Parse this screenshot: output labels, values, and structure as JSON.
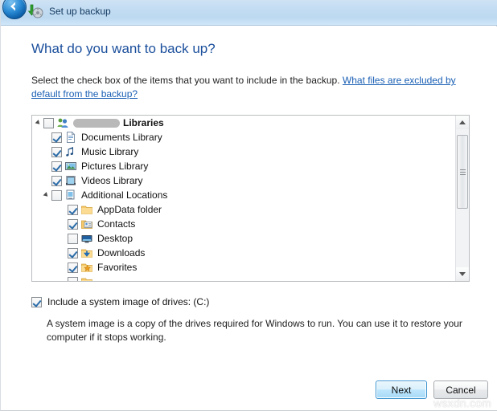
{
  "window": {
    "title": "Set up backup",
    "back_icon": "back-arrow-icon",
    "app_icon": "backup-icon"
  },
  "page": {
    "heading": "What do you want to back up?",
    "instruction_text": "Select the check box of the items that you want to include in the backup. ",
    "instruction_link": "What files are excluded by default from the backup?"
  },
  "tree": {
    "rows": [
      {
        "label": "Libraries",
        "redacted_prefix": true,
        "bold": true,
        "checked": false,
        "indent": 0,
        "twisty": true,
        "icon": "users-libraries-icon"
      },
      {
        "label": "Documents Library",
        "checked": true,
        "indent": 1,
        "twisty": false,
        "icon": "document-icon"
      },
      {
        "label": "Music Library",
        "checked": true,
        "indent": 1,
        "twisty": false,
        "icon": "music-note-icon"
      },
      {
        "label": "Pictures Library",
        "checked": true,
        "indent": 1,
        "twisty": false,
        "icon": "picture-icon"
      },
      {
        "label": "Videos Library",
        "checked": true,
        "indent": 1,
        "twisty": false,
        "icon": "video-film-icon"
      },
      {
        "label": "Additional Locations",
        "checked": false,
        "indent": 1,
        "twisty": true,
        "icon": "additional-locations-icon"
      },
      {
        "label": "AppData folder",
        "checked": true,
        "indent": 2,
        "twisty": false,
        "icon": "folder-icon"
      },
      {
        "label": "Contacts",
        "checked": true,
        "indent": 2,
        "twisty": false,
        "icon": "contacts-folder-icon"
      },
      {
        "label": "Desktop",
        "checked": false,
        "indent": 2,
        "twisty": false,
        "icon": "desktop-monitor-icon"
      },
      {
        "label": "Downloads",
        "checked": true,
        "indent": 2,
        "twisty": false,
        "icon": "downloads-folder-icon"
      },
      {
        "label": "Favorites",
        "checked": true,
        "indent": 2,
        "twisty": false,
        "icon": "favorites-folder-icon"
      },
      {
        "label": "",
        "checked": false,
        "indent": 2,
        "twisty": false,
        "icon": "folder-icon"
      }
    ],
    "scrollbar": {
      "up_arrow": "scroll-up-icon",
      "down_arrow": "scroll-down-icon"
    }
  },
  "system_image": {
    "checkbox_label": "Include a system image of drives: (C:)",
    "checked": true,
    "description": "A system image is a copy of the drives required for Windows to run. You can use it to restore your computer if it stops working."
  },
  "footer": {
    "next_label": "Next",
    "cancel_label": "Cancel"
  },
  "watermark": "wsxdn.com",
  "colors": {
    "heading": "#1b4f9c",
    "link": "#1a5fb4",
    "titlebar": "#c2dcf2",
    "accent_button_border": "#3c93cf"
  }
}
